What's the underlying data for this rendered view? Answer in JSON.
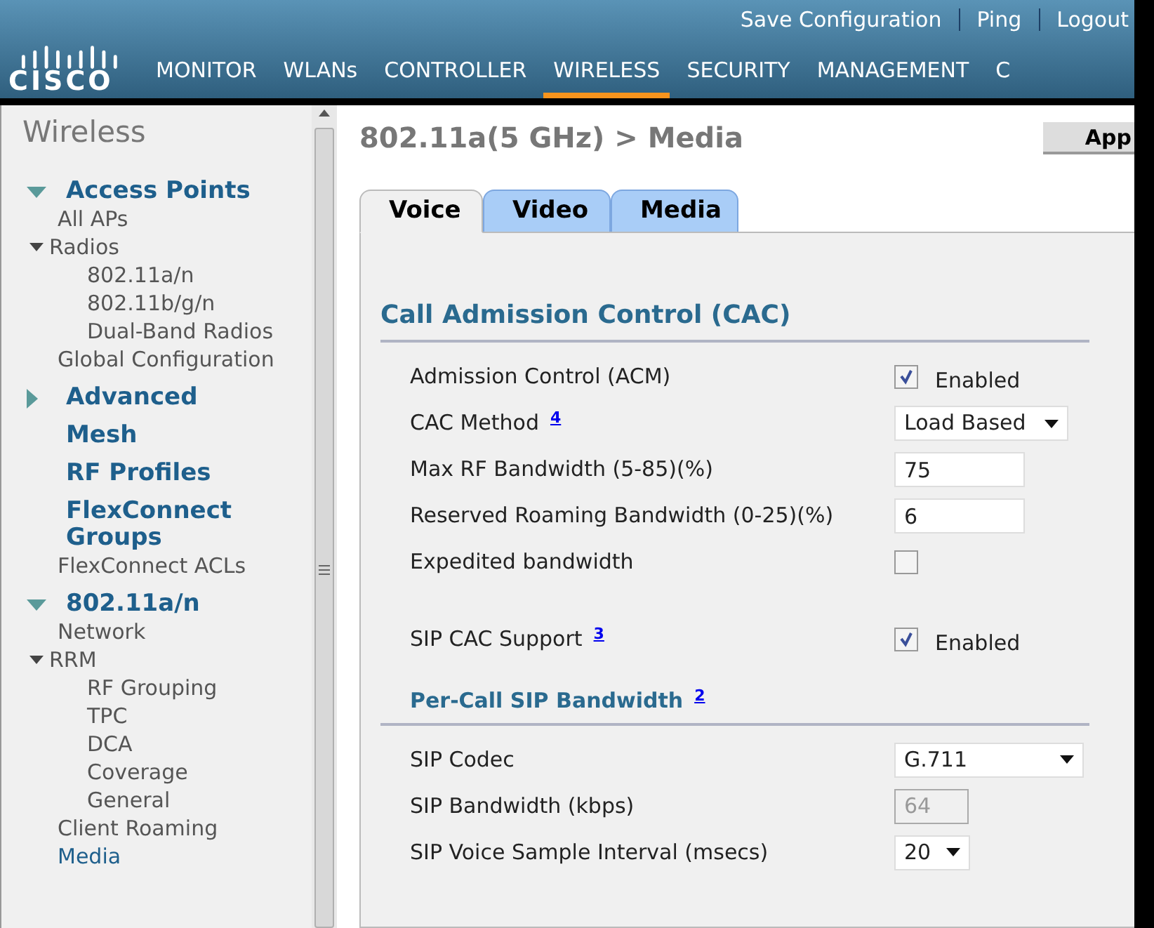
{
  "header": {
    "logo": "CISCO",
    "links": [
      "Save Configuration",
      "Ping",
      "Logout"
    ],
    "nav": [
      {
        "label": "MONITOR",
        "selected": false
      },
      {
        "label": "WLANs",
        "selected": false
      },
      {
        "label": "CONTROLLER",
        "selected": false
      },
      {
        "label": "WIRELESS",
        "selected": true
      },
      {
        "label": "SECURITY",
        "selected": false
      },
      {
        "label": "MANAGEMENT",
        "selected": false
      },
      {
        "label": "C",
        "selected": false
      }
    ]
  },
  "sidebar": {
    "title": "Wireless",
    "sections": [
      {
        "label": "Access Points",
        "expanded": true,
        "children": [
          {
            "label": "All APs",
            "selected": false
          },
          {
            "label": "Radios",
            "expanded": true,
            "selected": false,
            "children": [
              {
                "label": "802.11a/n",
                "selected": false
              },
              {
                "label": "802.11b/g/n",
                "selected": false
              },
              {
                "label": "Dual-Band Radios",
                "selected": false
              }
            ]
          },
          {
            "label": "Global Configuration",
            "selected": false
          }
        ]
      },
      {
        "label": "Advanced",
        "expanded": false
      },
      {
        "label": "Mesh"
      },
      {
        "label": "RF Profiles"
      },
      {
        "label": "FlexConnect Groups",
        "children": [
          {
            "label": "FlexConnect ACLs",
            "selected": false
          }
        ]
      },
      {
        "label": "802.11a/n",
        "expanded": true,
        "children": [
          {
            "label": "Network",
            "selected": false
          },
          {
            "label": "RRM",
            "expanded": true,
            "selected": false,
            "children": [
              {
                "label": "RF Grouping",
                "selected": false
              },
              {
                "label": "TPC",
                "selected": false
              },
              {
                "label": "DCA",
                "selected": false
              },
              {
                "label": "Coverage",
                "selected": false
              },
              {
                "label": "General",
                "selected": false
              }
            ]
          },
          {
            "label": "Client Roaming",
            "selected": false
          },
          {
            "label": "Media",
            "selected": true
          }
        ]
      }
    ]
  },
  "page": {
    "title": "802.11a(5 GHz) > Media",
    "apply_button": "App",
    "tabs": [
      {
        "label": "Voice",
        "selected": true
      },
      {
        "label": "Video",
        "selected": false
      },
      {
        "label": "Media",
        "selected": false
      }
    ],
    "sections": [
      {
        "title": "Call Admission Control (CAC)",
        "rows": [
          {
            "kind": "checkbox",
            "label": "Admission Control (ACM)",
            "checked": true,
            "text": "Enabled"
          },
          {
            "kind": "select",
            "label": "CAC Method",
            "note": "4",
            "value": "Load Based"
          },
          {
            "kind": "text",
            "label": "Max RF Bandwidth (5-85)(%)",
            "value": "75",
            "disabled": false
          },
          {
            "kind": "text",
            "label": "Reserved Roaming Bandwidth (0-25)(%)",
            "value": "6",
            "disabled": false
          },
          {
            "kind": "checkbox",
            "label": "Expedited bandwidth",
            "checked": false
          },
          {
            "kind": "checkbox",
            "label": "SIP CAC Support",
            "note": "3",
            "checked": true,
            "text": "Enabled"
          }
        ]
      },
      {
        "title": "Per-Call SIP Bandwidth",
        "note": "2",
        "rows": [
          {
            "kind": "select",
            "label": "SIP Codec",
            "value": "G.711"
          },
          {
            "kind": "text",
            "label": "SIP Bandwidth (kbps)",
            "value": "64",
            "disabled": true
          },
          {
            "kind": "select",
            "label": "SIP Voice Sample Interval (msecs)",
            "value": "20"
          }
        ]
      }
    ]
  }
}
